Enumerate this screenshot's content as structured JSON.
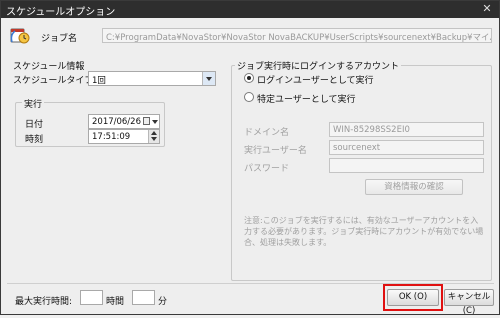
{
  "window": {
    "title": "スケジュールオプション",
    "close_glyph": "✕"
  },
  "job": {
    "label": "ジョブ名",
    "path": "C:¥ProgramData¥NovaStor¥NovaStor NovaBACKUP¥UserScripts¥sourcenext¥Backup¥マイバックアップ.nbk"
  },
  "schedule": {
    "group_title": "スケジュール情報",
    "type_label": "スケジュールタイプ",
    "type_value": "1回",
    "run_group_title": "実行",
    "date_label": "日付",
    "date_value": "2017/06/26",
    "time_label": "時刻",
    "time_value": "17:51:09"
  },
  "login": {
    "group_title": "ジョブ実行時にログインするアカウント",
    "radio_logged_in": "ログインユーザーとして実行",
    "radio_specific": "特定ユーザーとして実行",
    "selected": "logged_in",
    "domain_label": "ドメイン名",
    "domain_value": "WIN-85298SS2EI0",
    "user_label": "実行ユーザー名",
    "user_value": "sourcenext",
    "password_label": "パスワード",
    "password_value": "",
    "verify_button": "資格情報の確認",
    "note": "注意:このジョブを実行するには、有効なユーザーアカウントを入力する必要があります。ジョブ実行時にアカウントが有効でない場合、処理は失敗します。"
  },
  "footer": {
    "max_time_label": "最大実行時間:",
    "hours_value": "",
    "hours_unit": "時間",
    "minutes_value": "",
    "minutes_unit": "分",
    "ok_button": "OK (O)",
    "cancel_button": "キャンセル (C)"
  },
  "colors": {
    "titlebar": "#2e2e2e",
    "highlight": "#e01010"
  }
}
